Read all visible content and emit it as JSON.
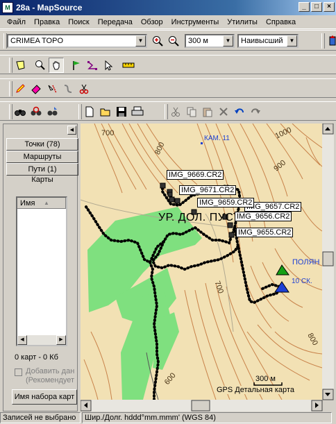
{
  "window": {
    "title": "28a - MapSource",
    "app_icon_text": "M"
  },
  "window_buttons": [
    "_",
    "□",
    "×"
  ],
  "menu": [
    "Файл",
    "Правка",
    "Поиск",
    "Передача",
    "Обзор",
    "Инструменты",
    "Утилиты",
    "Справка"
  ],
  "toolbar": {
    "map_product": "CRIMEA TOPO",
    "zoom_scale": "300 м",
    "detail_level": "Наивысший"
  },
  "left_pane": {
    "tabs": [
      "Точки (78)",
      "Маршруты",
      "Пути (1)",
      "Карты"
    ],
    "list_header": "Имя",
    "map_count": "0 карт - 0 Кб",
    "add_checkbox_label": "Добавить дан",
    "recommended_label": "(Рекомендует",
    "mapset_button": "Имя набора карт"
  },
  "map": {
    "area_label": "УР. ДОЛ. ПУСТЫННЫЙ",
    "contours": [
      "1000",
      "900",
      "800",
      "700",
      "700",
      "800",
      "600"
    ],
    "waypoints": [
      {
        "name": "IMG_9669.CR2"
      },
      {
        "name": "IMG_9671.CR2"
      },
      {
        "name": "IMG_9659.CR2"
      },
      {
        "name": "IMG_9657.CR2"
      },
      {
        "name": "IMG_9656.CR2"
      },
      {
        "name": "IMG_9655.CR2"
      }
    ],
    "kam_label": "КАМ. 11",
    "polyana_label": "ПОЛЯН",
    "ten_sk_label": "10 СК.",
    "scale_label": "300 м",
    "detail_label": "GPS Детальная карта"
  },
  "status": {
    "selection": "Записей не выбрано",
    "coords_format": "Шир./Долг. hddd°mm.mmm' (WGS 84)"
  },
  "colors": {
    "map_bg": "#f2e1b4",
    "forest": "#7fe07f",
    "contour": "#c8824a",
    "title_start": "#0a246a"
  }
}
